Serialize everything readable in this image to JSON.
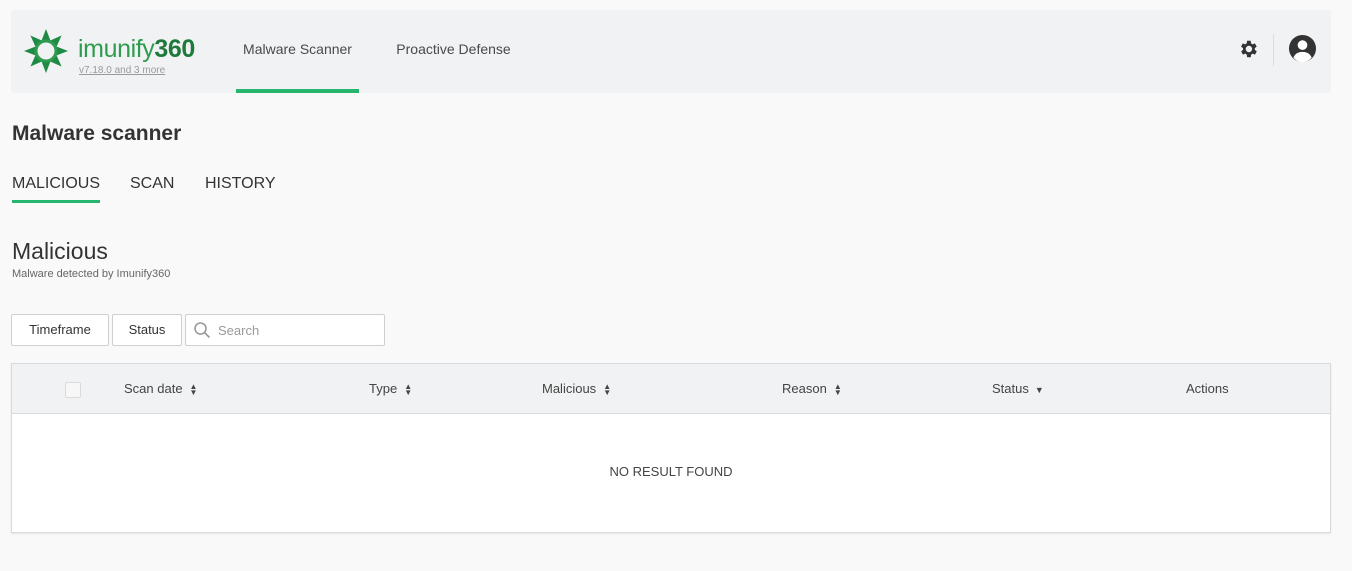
{
  "brand": {
    "name_light": "imunify",
    "name_bold": "360",
    "version": "v7.18.0 and 3 more",
    "color": "#2f9b4e"
  },
  "nav": {
    "items": [
      {
        "label": "Malware Scanner",
        "active": true
      },
      {
        "label": "Proactive Defense",
        "active": false
      }
    ],
    "settings_icon": "gear-icon",
    "user_icon": "user-avatar-icon"
  },
  "page": {
    "title": "Malware scanner"
  },
  "tabs": [
    {
      "label": "MALICIOUS",
      "active": true
    },
    {
      "label": "SCAN",
      "active": false
    },
    {
      "label": "HISTORY",
      "active": false
    }
  ],
  "section": {
    "title": "Malicious",
    "subtitle": "Malware detected by Imunify360"
  },
  "filters": {
    "timeframe_label": "Timeframe",
    "status_label": "Status",
    "search_placeholder": "Search",
    "search_value": ""
  },
  "table": {
    "columns": [
      {
        "label": "Scan date",
        "sort": "both"
      },
      {
        "label": "Type",
        "sort": "both"
      },
      {
        "label": "Malicious",
        "sort": "both"
      },
      {
        "label": "Reason",
        "sort": "both"
      },
      {
        "label": "Status",
        "sort": "desc"
      },
      {
        "label": "Actions",
        "sort": "none"
      }
    ],
    "empty_text": "NO RESULT FOUND"
  },
  "colors": {
    "accent": "#27b66d",
    "header_bg": "#f1f2f3",
    "page_bg": "#f9f9f9"
  }
}
